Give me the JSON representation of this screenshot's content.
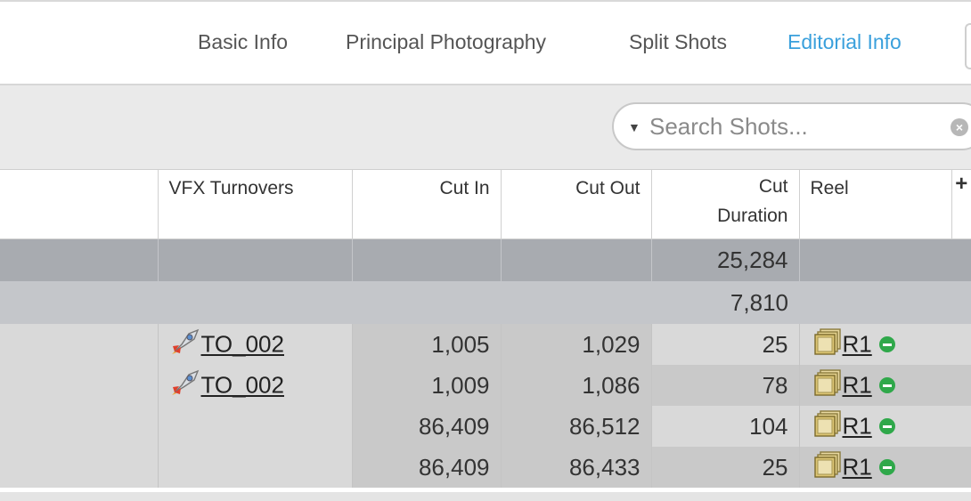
{
  "tabs": [
    {
      "label": "Basic Info",
      "active": false
    },
    {
      "label": "Principal Photography",
      "active": false
    },
    {
      "label": "Split Shots",
      "active": false
    },
    {
      "label": "Editorial Info",
      "active": true
    }
  ],
  "accent_color": "#3aa0dc",
  "search": {
    "placeholder": "Search Shots...",
    "value": ""
  },
  "table": {
    "columns": [
      "",
      "VFX Turnovers",
      "Cut In",
      "Cut Out",
      "Cut Duration",
      "Reel",
      "+"
    ],
    "group_total": {
      "cut_duration": "25,284"
    },
    "subgroup_total": {
      "cut_duration": "7,810"
    },
    "rows": [
      {
        "vfx_turnover": "TO_002",
        "cut_in": "1,005",
        "cut_out": "1,029",
        "cut_duration": "25",
        "reel": "R1",
        "status": "green"
      },
      {
        "vfx_turnover": "TO_002",
        "cut_in": "1,009",
        "cut_out": "1,086",
        "cut_duration": "78",
        "reel": "R1",
        "status": "green"
      },
      {
        "vfx_turnover": "",
        "cut_in": "86,409",
        "cut_out": "86,512",
        "cut_duration": "104",
        "reel": "R1",
        "status": "green"
      },
      {
        "vfx_turnover": "",
        "cut_in": "86,409",
        "cut_out": "86,433",
        "cut_duration": "25",
        "reel": "R1",
        "status": "green"
      }
    ]
  },
  "icons": {
    "turnover": "rocket-icon",
    "reel": "film-reel-icon",
    "status": "status-green-icon"
  }
}
